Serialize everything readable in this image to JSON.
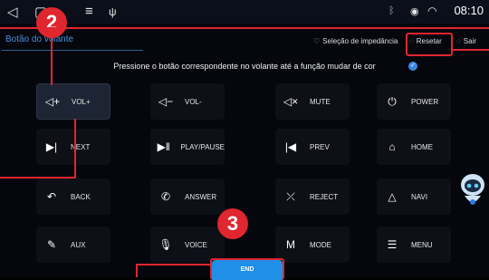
{
  "statusbar": {
    "time": "08:10",
    "icons": [
      "back-triangle-icon",
      "home-square-icon",
      "menu-icon",
      "usb-icon",
      "bluetooth-icon",
      "location-icon",
      "wifi-icon"
    ]
  },
  "tab": {
    "label": "Botão do volante"
  },
  "top_actions": {
    "impedance": "Seleção de impedância",
    "reset": "Resetar",
    "exit": "Sair"
  },
  "instruction": "Pressione o botão correspondente no volante até a função mudar de cor",
  "buttons": [
    {
      "label": "VOL+",
      "icon": "volume-up-icon"
    },
    {
      "label": "VOL-",
      "icon": "volume-down-icon"
    },
    {
      "label": "MUTE",
      "icon": "mute-icon"
    },
    {
      "label": "POWER",
      "icon": "power-icon"
    },
    {
      "label": "NEXT",
      "icon": "next-track-icon"
    },
    {
      "label": "PLAY/PAUSE",
      "icon": "play-pause-icon"
    },
    {
      "label": "PREV",
      "icon": "prev-track-icon"
    },
    {
      "label": "HOME",
      "icon": "home-icon"
    },
    {
      "label": "BACK",
      "icon": "back-arrow-icon"
    },
    {
      "label": "ANSWER",
      "icon": "phone-answer-icon"
    },
    {
      "label": "REJECT",
      "icon": "phone-reject-icon"
    },
    {
      "label": "NAVI",
      "icon": "navigation-icon"
    },
    {
      "label": "AUX",
      "icon": "aux-icon"
    },
    {
      "label": "VOICE",
      "icon": "voice-icon"
    },
    {
      "label": "MODE",
      "icon": "mode-icon"
    },
    {
      "label": "MENU",
      "icon": "menu-list-icon"
    }
  ],
  "end_button": {
    "label": "END"
  },
  "badges": {
    "step2": "2",
    "step3": "3"
  },
  "colors": {
    "accent_blue": "#1f8fe8",
    "annotation_red": "#e0262f",
    "tab_blue": "#4a8fd9"
  }
}
